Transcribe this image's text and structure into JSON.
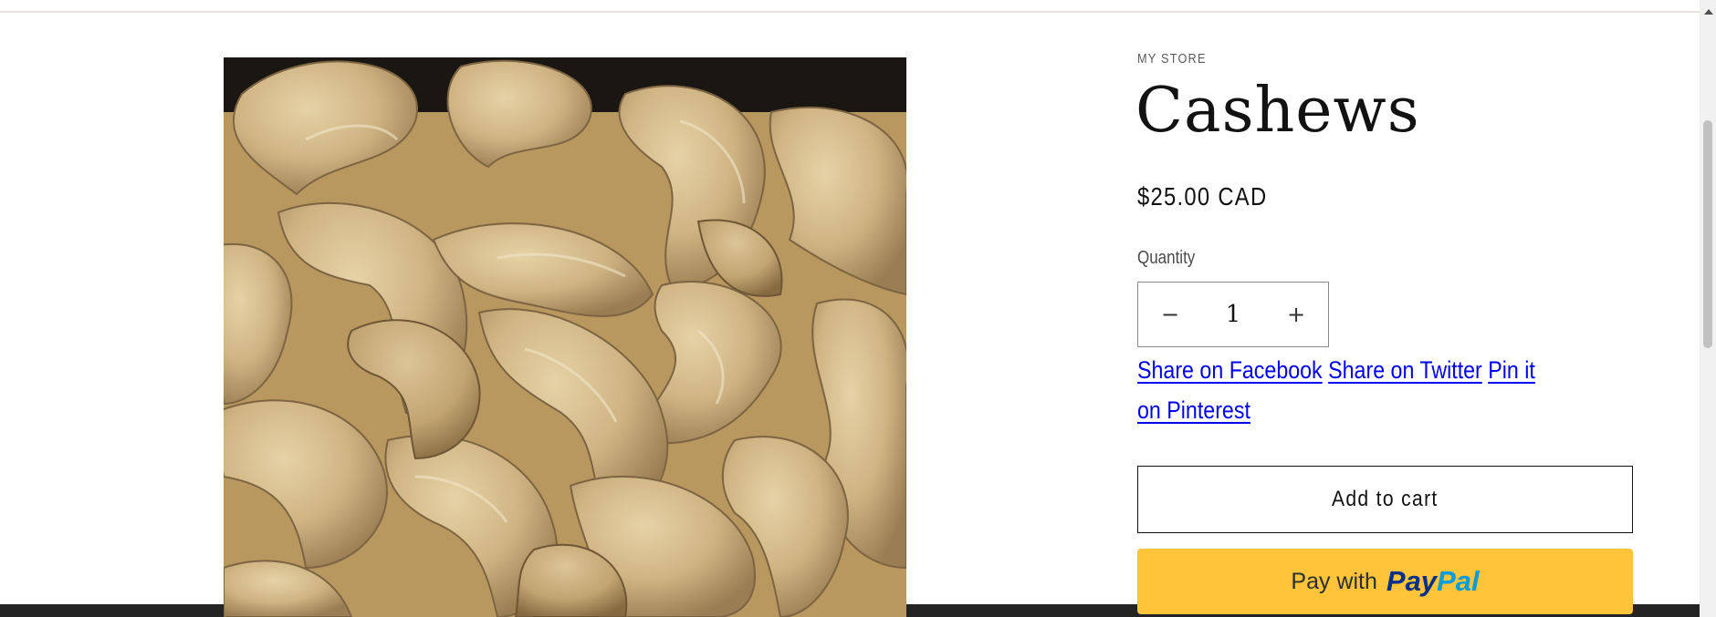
{
  "product": {
    "vendor": "MY STORE",
    "title": "Cashews",
    "price": "$25.00 CAD",
    "image_alt": "Cashews"
  },
  "quantity": {
    "label": "Quantity",
    "value": "1",
    "decrease_symbol": "−",
    "increase_symbol": "+"
  },
  "share": {
    "facebook": "Share on Facebook",
    "twitter": "Share on Twitter",
    "pinterest": "Pin it on Pinterest"
  },
  "buttons": {
    "add_to_cart": "Add to cart",
    "paypal_prefix": "Pay with",
    "paypal_brand_a": "Pay",
    "paypal_brand_b": "Pal"
  },
  "colors": {
    "paypal_yellow": "#ffc439",
    "link_blue": "#0000ee",
    "footer_dark": "#242424"
  }
}
